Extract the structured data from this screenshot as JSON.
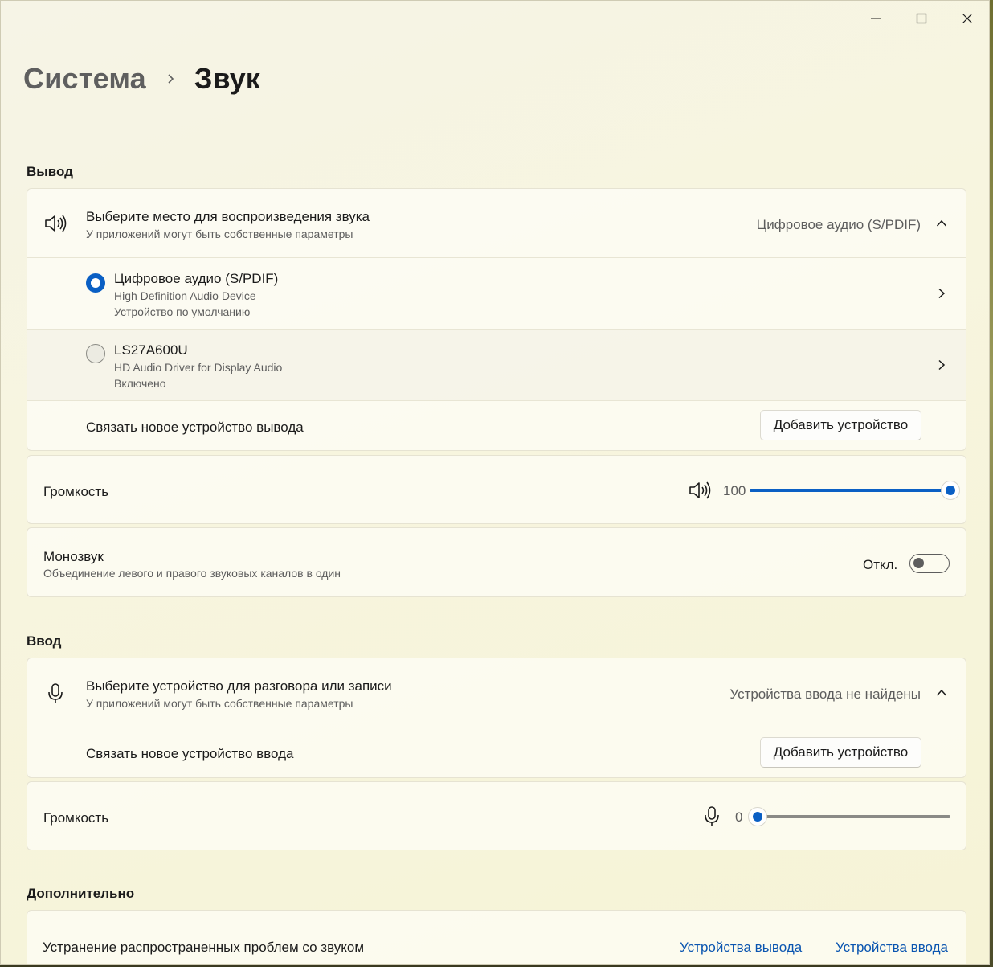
{
  "window": {
    "controls": [
      "minimize-icon",
      "maximize-icon",
      "close-icon"
    ]
  },
  "breadcrumb": {
    "parent": "Система",
    "current": "Звук"
  },
  "output": {
    "section_title": "Вывод",
    "choose": {
      "title": "Выберите место для воспроизведения звука",
      "subtitle": "У приложений могут быть собственные параметры",
      "selected_value": "Цифровое аудио (S/PDIF)"
    },
    "devices": [
      {
        "name": "Цифровое аудио (S/PDIF)",
        "driver": "High Definition Audio Device",
        "status": "Устройство по умолчанию",
        "selected": true
      },
      {
        "name": "LS27A600U",
        "driver": "HD Audio Driver for Display Audio",
        "status": "Включено",
        "selected": false
      }
    ],
    "pair": {
      "label": "Связать новое устройство вывода",
      "button": "Добавить устройство"
    },
    "volume": {
      "label": "Громкость",
      "value": "100",
      "level": 1.0
    },
    "mono": {
      "title": "Монозвук",
      "subtitle": "Объединение левого и правого звуковых каналов в один",
      "state": "Откл.",
      "on": false
    }
  },
  "input": {
    "section_title": "Ввод",
    "choose": {
      "title": "Выберите устройство для разговора или записи",
      "subtitle": "У приложений могут быть собственные параметры",
      "selected_value": "Устройства ввода не найдены"
    },
    "pair": {
      "label": "Связать новое устройство ввода",
      "button": "Добавить устройство"
    },
    "volume": {
      "label": "Громкость",
      "value": "0",
      "level": 0.0
    }
  },
  "advanced": {
    "section_title": "Дополнительно",
    "troubleshoot": {
      "label": "Устранение распространенных проблем со звуком",
      "link_output": "Устройства вывода",
      "link_input": "Устройства ввода"
    }
  },
  "colors": {
    "accent": "#0a5fc4",
    "link": "#0a55b0"
  }
}
